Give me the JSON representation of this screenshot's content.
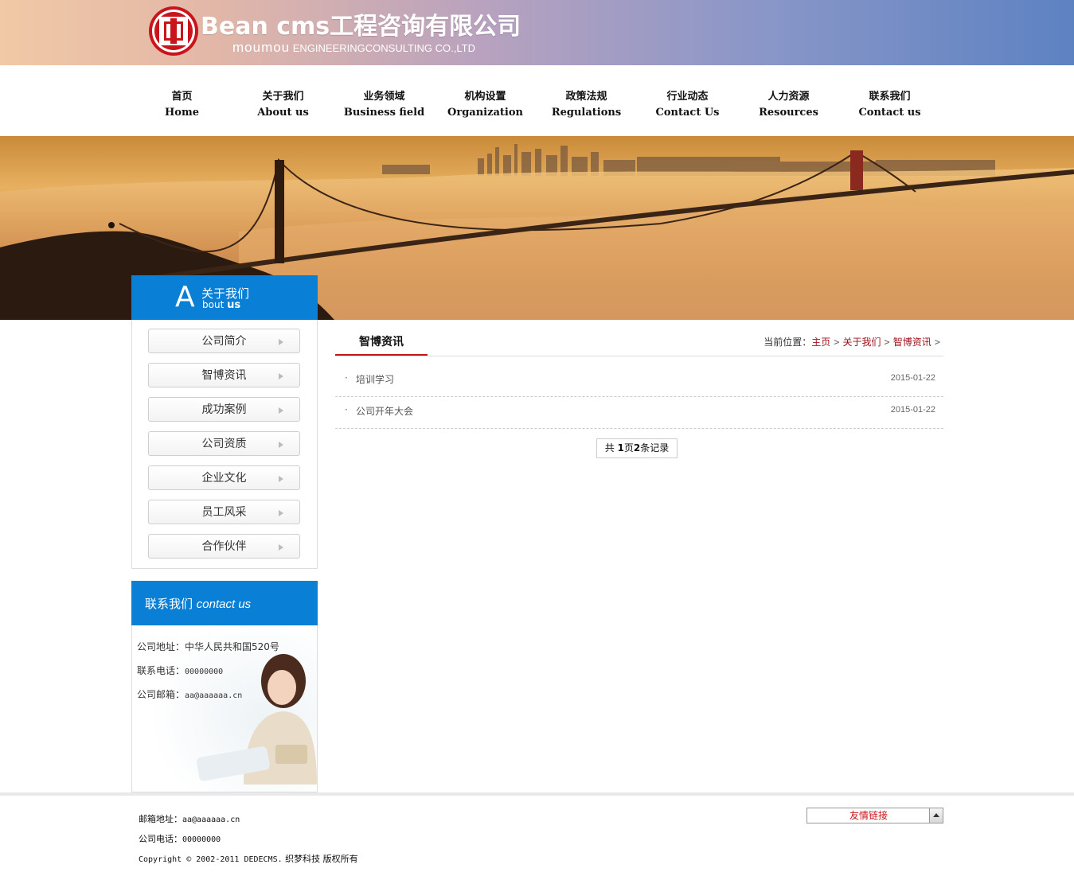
{
  "header": {
    "brand_en": "Bean cms",
    "brand_cn": "工程咨询有限公司",
    "sub_big": "moumou",
    "sub_small": "ENGINEERINGCONSULTING CO.,LTD"
  },
  "nav": [
    {
      "cn": "首页",
      "en": "Home"
    },
    {
      "cn": "关于我们",
      "en": "About us"
    },
    {
      "cn": "业务领域",
      "en": "Business field"
    },
    {
      "cn": "机构设置",
      "en": "Organization"
    },
    {
      "cn": "政策法规",
      "en": "Regulations"
    },
    {
      "cn": "行业动态",
      "en": "Contact Us"
    },
    {
      "cn": "人力资源",
      "en": "Resources"
    },
    {
      "cn": "联系我们",
      "en": "Contact us"
    }
  ],
  "sidebar": {
    "head_letter": "A",
    "head_cn": "关于我们",
    "head_en_a": "bout",
    "head_en_b": "us",
    "items": [
      "公司简介",
      "智博资讯",
      "成功案例",
      "公司资质",
      "企业文化",
      "员工风采",
      "合作伙伴"
    ]
  },
  "contact": {
    "head_cn": "联系我们",
    "head_en": "contact us",
    "address_label": "公司地址：",
    "address": "中华人民共和国520号",
    "phone_label": "联系电话：",
    "phone": "00000000",
    "email_label": "公司邮箱：",
    "email": "aa@aaaaaa.cn"
  },
  "content": {
    "tab_title": "智博资讯",
    "crumb_label": "当前位置：",
    "crumb": [
      "主页",
      "关于我们",
      "智博资讯"
    ],
    "crumb_sep": ">",
    "list": [
      {
        "bullet": "·",
        "title": "培训学习",
        "date": "2015-01-22"
      },
      {
        "bullet": "·",
        "title": "公司开年大会",
        "date": "2015-01-22"
      }
    ],
    "pager_a": "共 ",
    "pager_b": "1",
    "pager_c": "页",
    "pager_d": "2",
    "pager_e": "条记录"
  },
  "footer": {
    "email_label": "邮箱地址：",
    "email": "aa@aaaaaa.cn",
    "phone_label": "公司电话：",
    "phone": "00000000",
    "copyright_a": "Copyright © 2002-2011 DEDECMS.",
    "copyright_b": " 织梦科技 版权所有",
    "links_label": "友情链接"
  },
  "colors": {
    "accent_blue": "#0a7fd6",
    "accent_red": "#c8141a"
  }
}
